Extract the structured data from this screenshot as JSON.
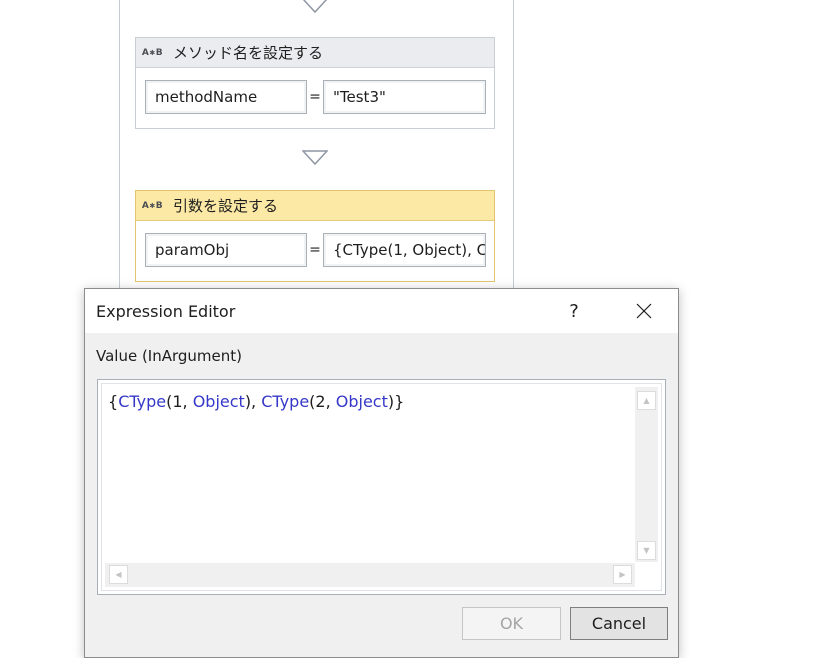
{
  "workflow": {
    "activities": [
      {
        "title": "メソッド名を設定する",
        "icon": "assign-icon",
        "icon_text": "A",
        "icon_text2": "B",
        "to": "methodName",
        "equals": "=",
        "value": "\"Test3\"",
        "selected": false
      },
      {
        "title": "引数を設定する",
        "icon": "assign-icon",
        "icon_text": "A",
        "icon_text2": "B",
        "to": "paramObj",
        "equals": "=",
        "value": "{CType(1, Object), CType(2, Object)}",
        "selected": true
      }
    ]
  },
  "dialog": {
    "title": "Expression Editor",
    "help_label": "?",
    "close_icon": "close-icon",
    "argument_label": "Value (InArgument)",
    "expression_tokens": [
      {
        "text": "{",
        "kind": "plain"
      },
      {
        "text": "CType",
        "kind": "keyword"
      },
      {
        "text": "(1, ",
        "kind": "plain"
      },
      {
        "text": "Object",
        "kind": "keyword"
      },
      {
        "text": "), ",
        "kind": "plain"
      },
      {
        "text": "CType",
        "kind": "keyword"
      },
      {
        "text": "(2, ",
        "kind": "plain"
      },
      {
        "text": "Object",
        "kind": "keyword"
      },
      {
        "text": ")}",
        "kind": "plain"
      }
    ],
    "ok_label": "OK",
    "ok_enabled": false,
    "cancel_label": "Cancel"
  },
  "colors": {
    "keyword": "#3538c8",
    "selected_header": "#fce9a6",
    "header": "#eaecef"
  }
}
